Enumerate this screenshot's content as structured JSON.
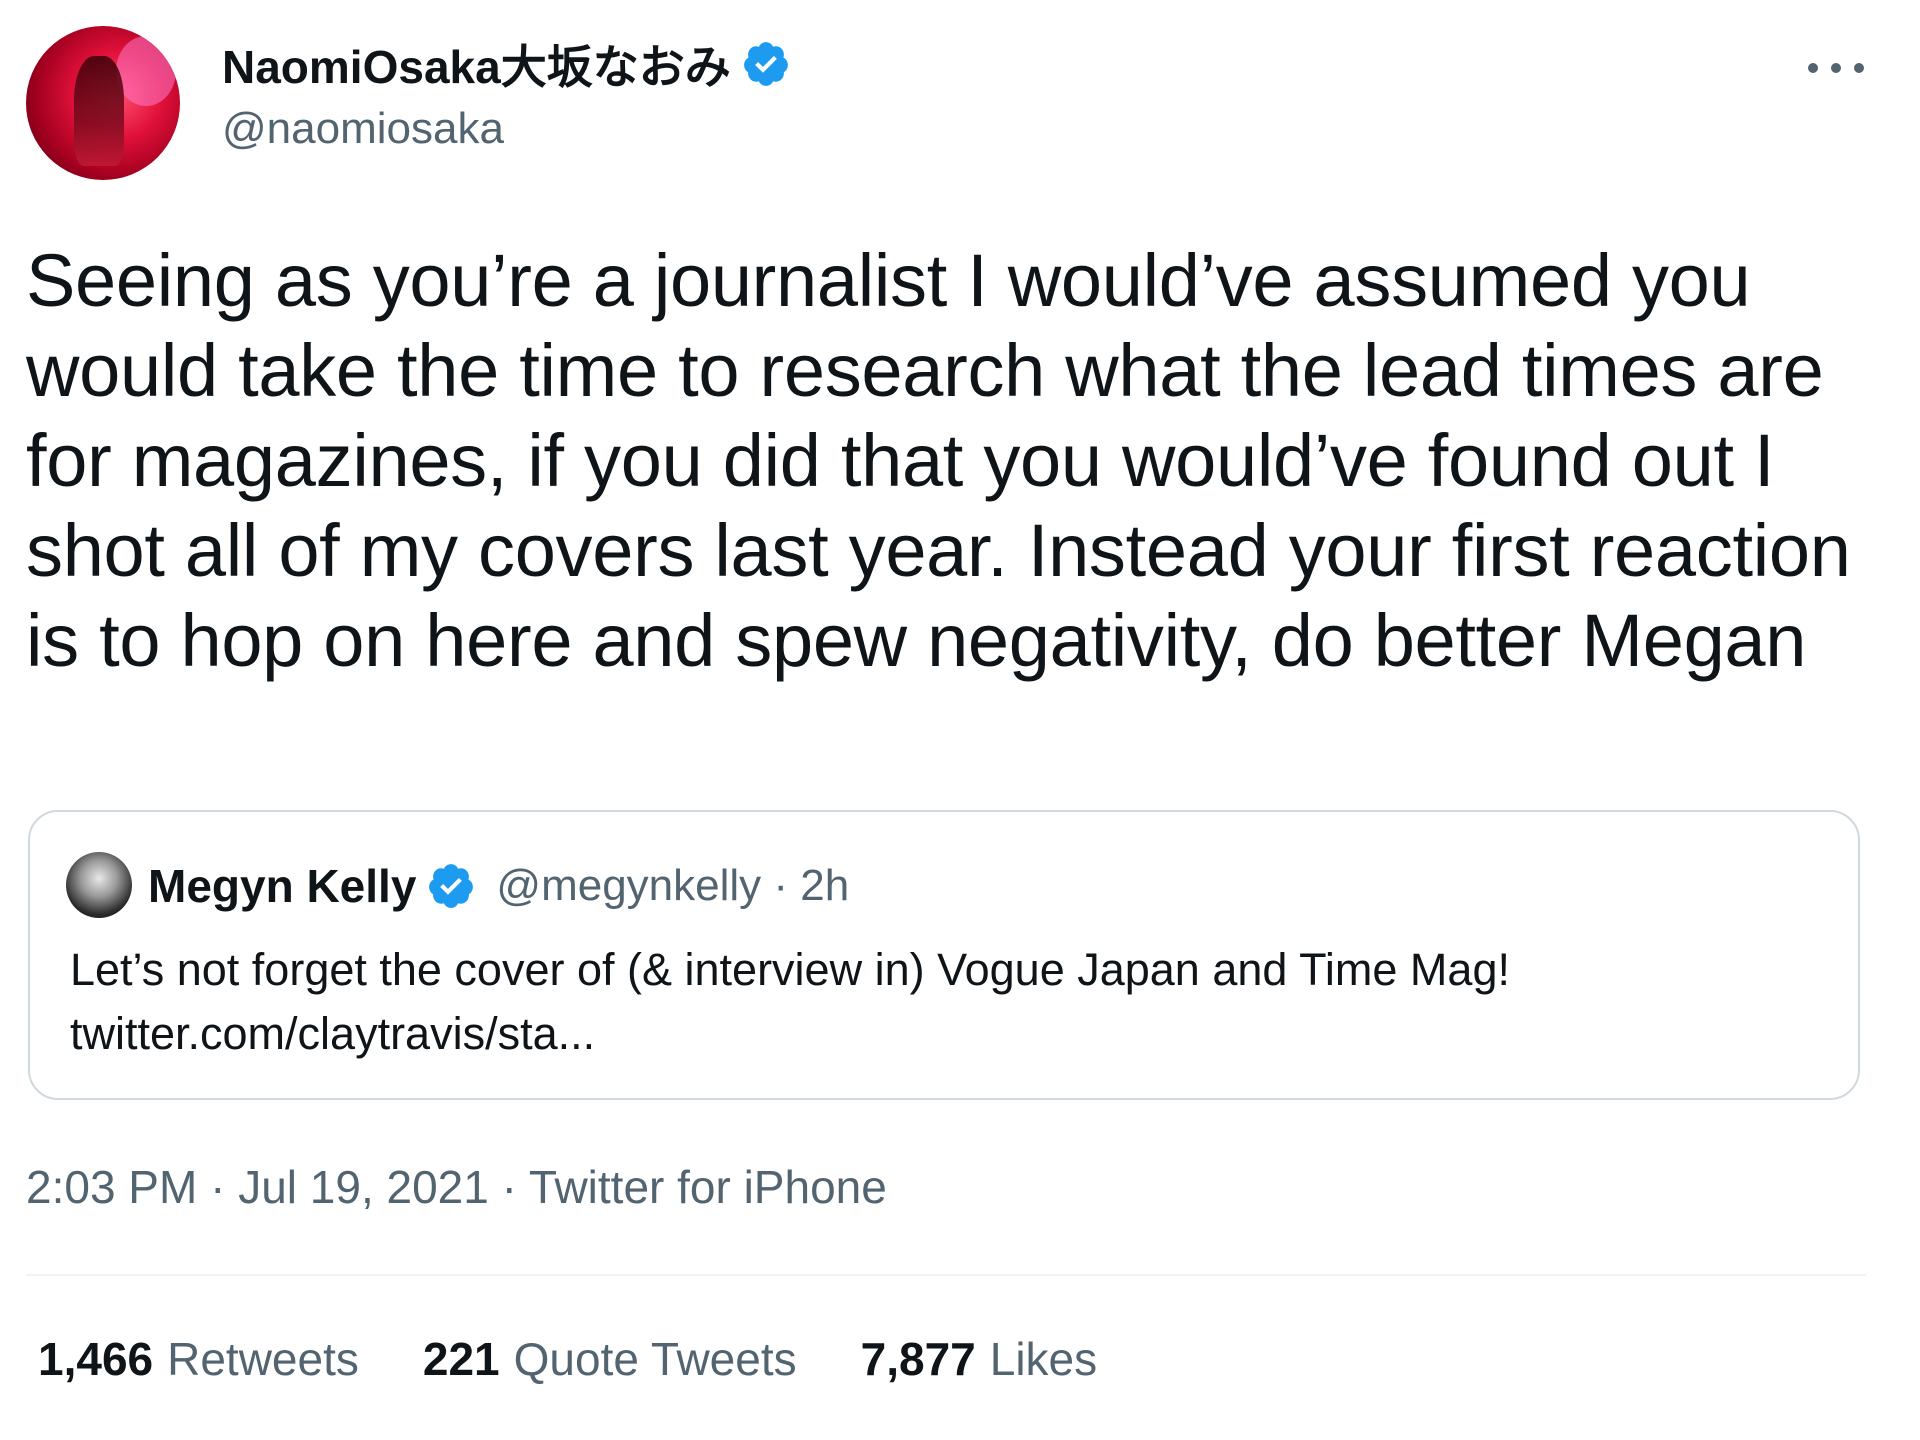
{
  "tweet": {
    "author": {
      "display_name": "NaomiOsaka大坂なおみ",
      "handle": "@naomiosaka",
      "verified": true
    },
    "body": "Seeing as you’re a journalist I would’ve assumed you would take the time to research what the lead times are for magazines, if you did that you would’ve found out I shot all of my covers last year. Instead your first reaction is to hop on here and spew negativity, do better Megan",
    "quoted": {
      "display_name": "Megyn Kelly",
      "handle_time": "@megynkelly · 2h",
      "verified": true,
      "text": "Let’s not forget the cover of (& interview in) Vogue Japan and Time Mag!",
      "link": "twitter.com/claytravis/sta..."
    },
    "meta": "2:03 PM · Jul 19, 2021 · Twitter for iPhone",
    "stats": {
      "retweets_count": "1,466",
      "retweets_label": "Retweets",
      "quotes_count": "221",
      "quotes_label": "Quote Tweets",
      "likes_count": "7,877",
      "likes_label": "Likes"
    },
    "icons": {
      "verified": "verified-badge-icon",
      "more": "more-options-icon"
    },
    "colors": {
      "verified_blue": "#1d9bf0",
      "secondary_text": "#536471"
    }
  }
}
